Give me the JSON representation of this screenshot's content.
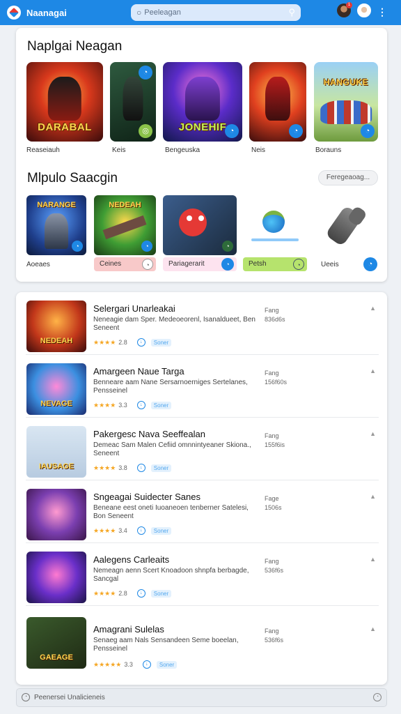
{
  "header": {
    "app_title": "Naanagai",
    "search_placeholder": "Peeleagan",
    "notification_count": "1"
  },
  "featured": {
    "title": "Naplgai Neagan",
    "tiles": [
      {
        "art": "DARABAL",
        "label": "Reaseiauh"
      },
      {
        "art": "",
        "label": "Keis"
      },
      {
        "art": "JONEHIF",
        "label": "Bengeuska"
      },
      {
        "art": "",
        "label": "Neis"
      },
      {
        "art": "HANGUKE",
        "label": "Borauns"
      }
    ]
  },
  "multiplayer": {
    "title": "Mlpulo Saacgin",
    "more_label": "Feregeaoag...",
    "tiles": [
      {
        "art": "NARANGE",
        "label": "Aoeaes"
      },
      {
        "art": "NEDEAH",
        "label": "Ceines"
      },
      {
        "art": "",
        "label": "Pariagerarit"
      },
      {
        "art": "",
        "label": "Petsh"
      },
      {
        "art": "",
        "label": "Ueeis"
      }
    ]
  },
  "list": [
    {
      "title": "Selergari Unarleakai",
      "desc": "Neneagie dam Sper. Medeoeorenl, Isanaldueet, Ben Seneent",
      "rating": "2.8",
      "stars": "★★★★",
      "tag": "Soner",
      "price": "Fang",
      "size": "836d6s",
      "art": "NEDEAH"
    },
    {
      "title": "Amargeen Naue Targa",
      "desc": "Benneare aam Nane Sersarnoerniges Sertelanes, Pensseinel",
      "rating": "3.3",
      "stars": "★★★★",
      "tag": "Soner",
      "price": "Fang",
      "size": "156f60s",
      "art": "NEVAGE"
    },
    {
      "title": "Pakergesc Nava Seeffealan",
      "desc": "Demeac Sam Malen Cefiid omnnintyeaner Skiona., Seneent",
      "rating": "3.8",
      "stars": "★★★★",
      "tag": "Soner",
      "price": "Fang",
      "size": "155f6is",
      "art": "IAUSAGE"
    },
    {
      "title": "Sngeagai Suidecter Sanes",
      "desc": "Beneane eest oneti Iuoaneoen tenberner Satelesi, Bon Seneent",
      "rating": "3.4",
      "stars": "★★★★",
      "tag": "Soner",
      "price": "Fage",
      "size": "1506s",
      "art": ""
    },
    {
      "title": "Aalegens Carleaits",
      "desc": "Nemeagn aenn Scert Knoadoon shnpfa berbagde, Sancgal",
      "rating": "2.8",
      "stars": "★★★★",
      "tag": "Soner",
      "price": "Fang",
      "size": "536f6s",
      "art": ""
    },
    {
      "title": "Amagrani Sulelas",
      "desc": "Senaeg aam Nals Sensandeen Seme boeelan, Pensseinel",
      "rating": "3.3",
      "stars": "★★★★★",
      "tag": "Soner",
      "price": "Fang",
      "size": "536f6s",
      "art": "GAEAGE"
    }
  ],
  "footer": {
    "text": "Peenersei Unalicieneis"
  }
}
